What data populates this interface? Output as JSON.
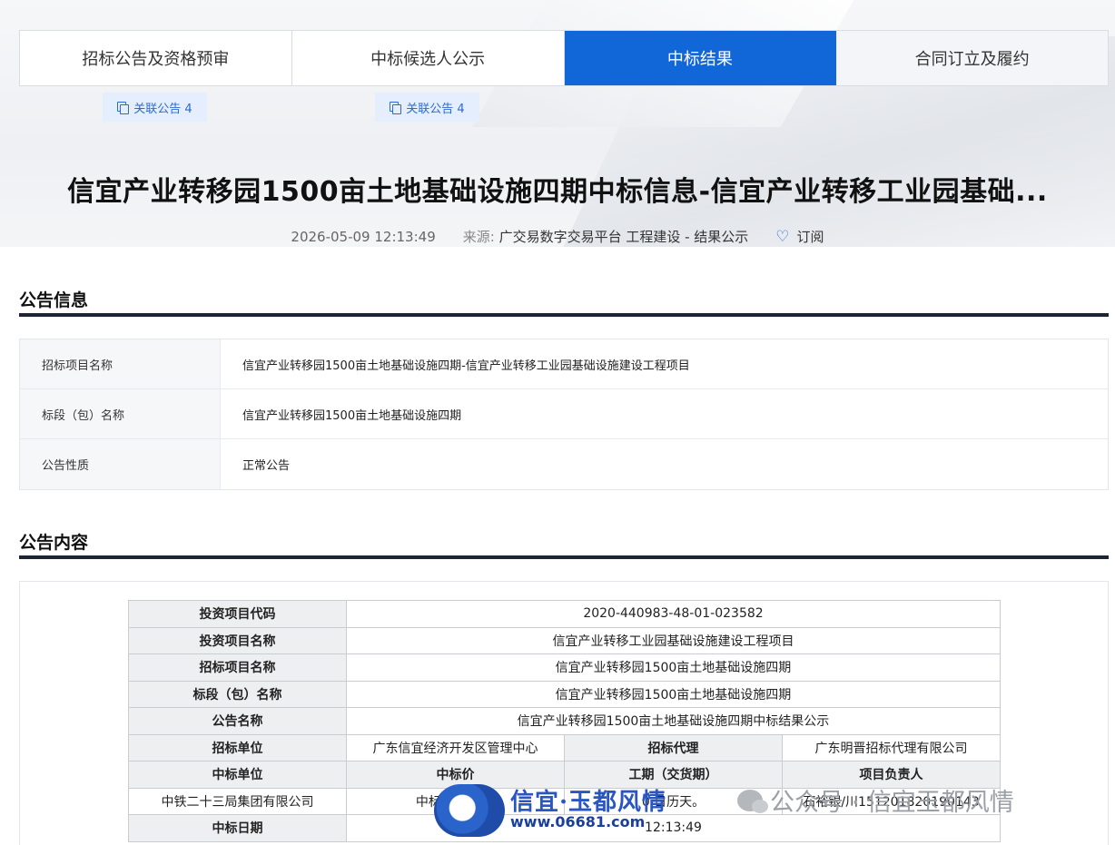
{
  "tabs": [
    {
      "label": "招标公告及资格预审",
      "active": false
    },
    {
      "label": "中标候选人公示",
      "active": false
    },
    {
      "label": "中标结果",
      "active": true
    },
    {
      "label": "合同订立及履约",
      "active": false
    }
  ],
  "related": [
    {
      "label": "关联公告 4"
    },
    {
      "label": "关联公告 4"
    }
  ],
  "title": "信宜产业转移园1500亩土地基础设施四期中标信息-信宜产业转移工业园基础...",
  "meta": {
    "datetime": "2026-05-09 12:13:49",
    "source_label": "来源:",
    "source_value": "广交易数字交易平台 工程建设 - 结果公示",
    "subscribe": "订阅"
  },
  "info_section": {
    "title": "公告信息",
    "rows": [
      {
        "key": "招标项目名称",
        "value": "信宜产业转移园1500亩土地基础设施四期-信宜产业转移工业园基础设施建设工程项目"
      },
      {
        "key": "标段（包）名称",
        "value": "信宜产业转移园1500亩土地基础设施四期"
      },
      {
        "key": "公告性质",
        "value": "正常公告"
      }
    ]
  },
  "content_section": {
    "title": "公告内容",
    "table": {
      "invest_code_label": "投资项目代码",
      "invest_code": "2020-440983-48-01-023582",
      "invest_name_label": "投资项目名称",
      "invest_name": "信宜产业转移工业园基础设施建设工程项目",
      "bid_project_label": "招标项目名称",
      "bid_project": "信宜产业转移园1500亩土地基础设施四期",
      "section_label": "标段（包）名称",
      "section": "信宜产业转移园1500亩土地基础设施四期",
      "notice_name_label": "公告名称",
      "notice_name": "信宜产业转移园1500亩土地基础设施四期中标结果公示",
      "tenderer_label": "招标单位",
      "tenderer": "广东信宜经济开发区管理中心",
      "agent_label": "招标代理",
      "agent": "广东明晋招标代理有限公司",
      "winner_label": "中标单位",
      "price_label": "中标价",
      "period_label": "工期（交货期）",
      "manager_label": "项目负责人",
      "winner": "中铁二十三局集团有限公司",
      "price": "中标总价52...",
      "period": "0 日历天。",
      "manager": "石裕银/川151201820190143",
      "win_date_label": "中标日期",
      "win_date": "12:13:49"
    }
  },
  "watermark": {
    "brand": "信宜·玉都风情",
    "url": "www.06681.com",
    "wechat": "公众号 · 信宜玉都风情"
  }
}
